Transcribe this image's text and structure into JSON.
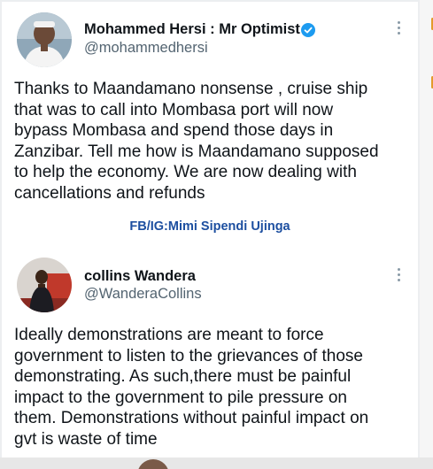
{
  "tweets": [
    {
      "name": "Mohammed Hersi : Mr Optimist",
      "handle": "@mohammedhersi",
      "verified": true,
      "more_icon": "more-vertical-icon",
      "lines": [
        "Thanks to Maandamano nonsense , cruise ship",
        "that was to call into Mombasa port will now",
        "bypass Mombasa and spend those days in",
        "Zanzibar. Tell me how is Maandamano supposed",
        "to help the economy. We are now dealing with",
        "cancellations and refunds"
      ]
    },
    {
      "name": "collins Wandera",
      "handle": "@WanderaCollins",
      "verified": false,
      "more_icon": "more-vertical-icon",
      "lines": [
        "Ideally demonstrations are meant to force",
        "government to listen to the grievances of those",
        "demonstrating. As such,there must be painful",
        "impact to the government to pile pressure on",
        "them. Demonstrations without painful impact on",
        "gvt is waste of time"
      ]
    }
  ],
  "watermark": "FB/IG:Mimi Sipendi Ujinga",
  "colors": {
    "accent_verified": "#1d9bf0",
    "watermark": "#1d4fa0",
    "text": "#0f1419",
    "handle": "#536471"
  }
}
